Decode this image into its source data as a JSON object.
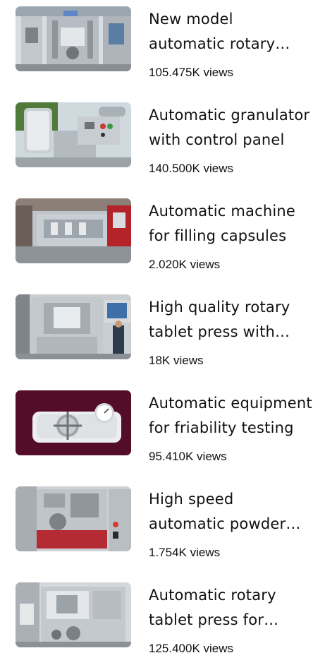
{
  "videos": [
    {
      "title": "New model automatic rotary tablet press",
      "views": "105.475K views",
      "thumb_icon": "rotary-press-thumbnail"
    },
    {
      "title": "Automatic granulator with control panel",
      "views": "140.500K views",
      "thumb_icon": "granulator-thumbnail"
    },
    {
      "title": "Automatic machine for filling capsules",
      "views": "2.020K views",
      "thumb_icon": "capsule-filler-thumbnail"
    },
    {
      "title": "High quality rotary tablet press with touch screen",
      "views": "18K views",
      "thumb_icon": "tablet-press-thumbnail"
    },
    {
      "title": "Automatic equipment for friability testing",
      "views": "95.410K views",
      "thumb_icon": "tester-thumbnail"
    },
    {
      "title": "High speed automatic powder capsule filler",
      "views": "1.754K views",
      "thumb_icon": "powder-filler-thumbnail"
    },
    {
      "title": "Automatic rotary tablet press for pharmacy",
      "views": "125.400K views",
      "thumb_icon": "rotary-tablet-thumbnail"
    }
  ]
}
